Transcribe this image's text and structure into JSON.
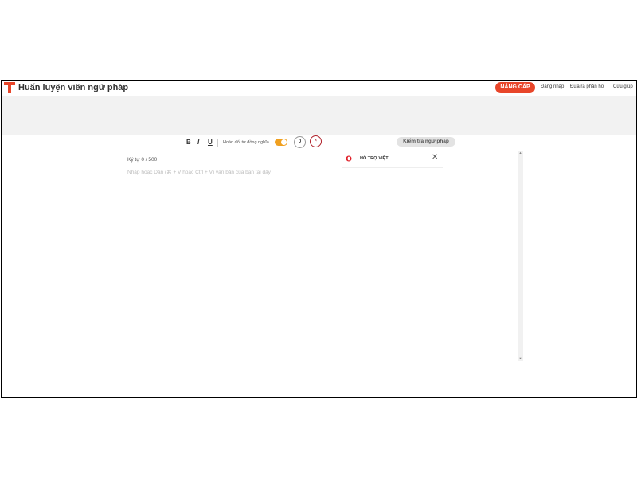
{
  "header": {
    "app_title": "Huấn luyện viên ngữ pháp",
    "upgrade_label": "NÂNG CẤP",
    "nav": {
      "login": "Đăng nhập",
      "feedback": "Đưa ra phản hồi",
      "help": "Cứu giúp"
    }
  },
  "toolbar": {
    "bold": "B",
    "italic": "I",
    "underline": "U",
    "synonym_toggle_label": "Hoán đổi từ đồng nghĩa",
    "synonym_toggle_on": true,
    "error_count": "0",
    "clear_symbol": "×",
    "check_button": "Kiểm tra ngữ pháp"
  },
  "editor": {
    "char_label": "Ký tự",
    "char_count": "0 / 500",
    "placeholder": "Nhập hoặc Dán (⌘ + V hoặc Ctrl + V) văn bản của bạn tại đây"
  },
  "side_panel": {
    "title": "HỖ TRỢ VIỆT",
    "close_symbol": "✕"
  },
  "colors": {
    "brand": "#e8462a",
    "toggle_on": "#f0a020",
    "clear_ring": "#b0202a"
  }
}
